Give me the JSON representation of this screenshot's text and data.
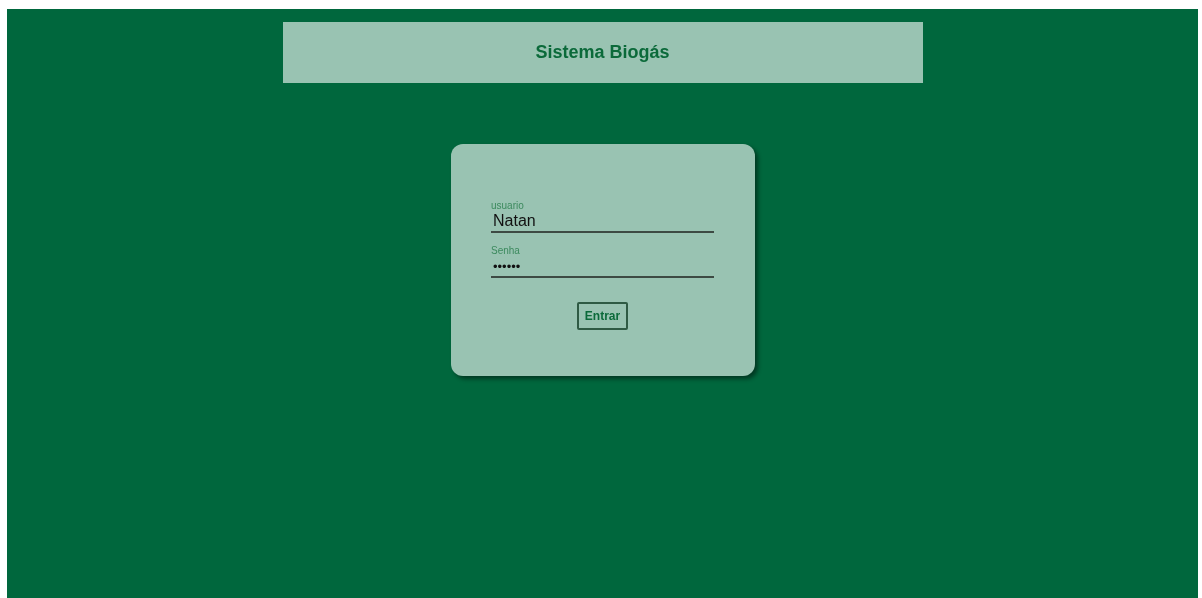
{
  "header": {
    "title": "Sistema Biogás"
  },
  "login_form": {
    "fields": [
      {
        "label": "usuario",
        "value": "Natan"
      },
      {
        "label": "Senha",
        "value": "••••••"
      }
    ],
    "submit_button": "Entrar"
  }
}
